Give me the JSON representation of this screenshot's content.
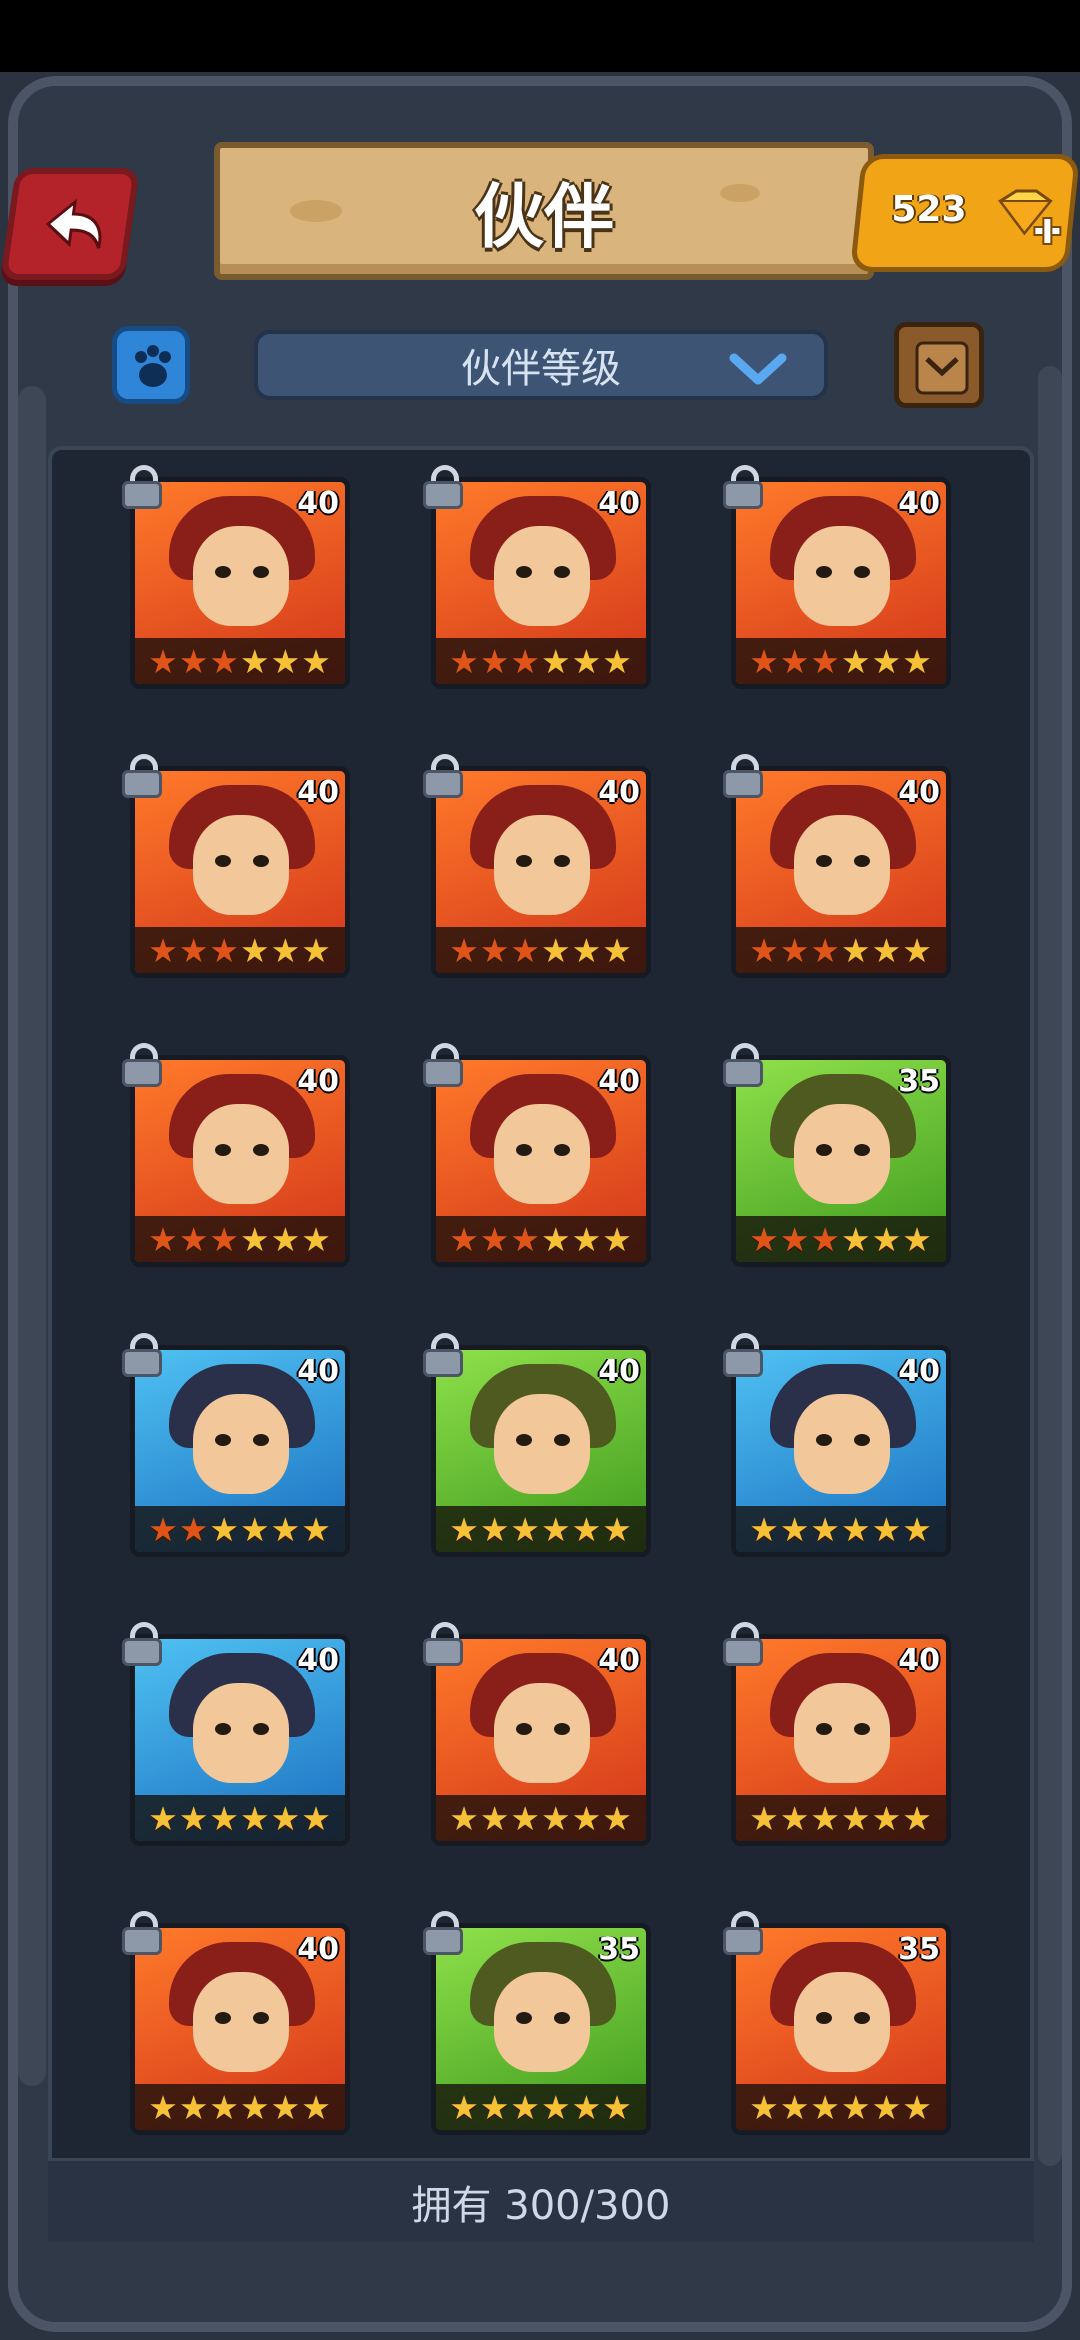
{
  "header": {
    "title": "伙伴",
    "gems": "523"
  },
  "filter": {
    "dropdown_label": "伙伴等级"
  },
  "footer": {
    "owned_label": "拥有 300/300"
  },
  "colors": {
    "star_active": "#e0541a",
    "star_base": "#f6c136"
  },
  "companions": [
    {
      "level": "40",
      "stars_red": 3,
      "stars_total": 6,
      "theme": "red"
    },
    {
      "level": "40",
      "stars_red": 3,
      "stars_total": 6,
      "theme": "red"
    },
    {
      "level": "40",
      "stars_red": 3,
      "stars_total": 6,
      "theme": "red"
    },
    {
      "level": "40",
      "stars_red": 3,
      "stars_total": 6,
      "theme": "red"
    },
    {
      "level": "40",
      "stars_red": 3,
      "stars_total": 6,
      "theme": "red"
    },
    {
      "level": "40",
      "stars_red": 3,
      "stars_total": 6,
      "theme": "red"
    },
    {
      "level": "40",
      "stars_red": 3,
      "stars_total": 6,
      "theme": "red"
    },
    {
      "level": "40",
      "stars_red": 3,
      "stars_total": 6,
      "theme": "red"
    },
    {
      "level": "35",
      "stars_red": 3,
      "stars_total": 6,
      "theme": "green"
    },
    {
      "level": "40",
      "stars_red": 2,
      "stars_total": 6,
      "theme": "blue"
    },
    {
      "level": "40",
      "stars_red": 0,
      "stars_total": 6,
      "theme": "green"
    },
    {
      "level": "40",
      "stars_red": 0,
      "stars_total": 6,
      "theme": "blue"
    },
    {
      "level": "40",
      "stars_red": 0,
      "stars_total": 6,
      "theme": "blue"
    },
    {
      "level": "40",
      "stars_red": 0,
      "stars_total": 6,
      "theme": "red"
    },
    {
      "level": "40",
      "stars_red": 0,
      "stars_total": 6,
      "theme": "red"
    },
    {
      "level": "40",
      "stars_red": 0,
      "stars_total": 6,
      "theme": "red"
    },
    {
      "level": "35",
      "stars_red": 0,
      "stars_total": 6,
      "theme": "green"
    },
    {
      "level": "35",
      "stars_red": 0,
      "stars_total": 6,
      "theme": "red"
    }
  ]
}
